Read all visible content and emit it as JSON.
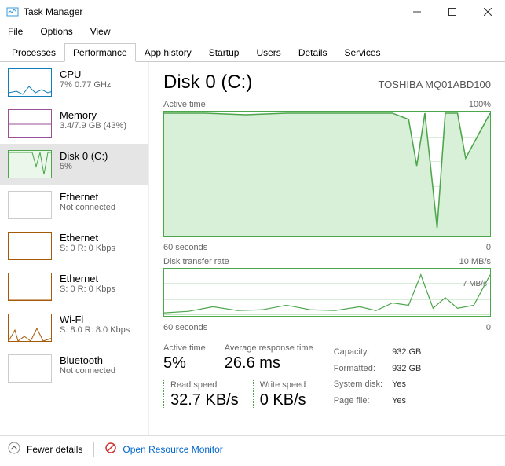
{
  "window": {
    "title": "Task Manager"
  },
  "menu": {
    "file": "File",
    "options": "Options",
    "view": "View"
  },
  "tabs": {
    "processes": "Processes",
    "performance": "Performance",
    "app_history": "App history",
    "startup": "Startup",
    "users": "Users",
    "details": "Details",
    "services": "Services"
  },
  "sidebar": [
    {
      "title": "CPU",
      "sub": "7% 0.77 GHz",
      "kind": "cpu"
    },
    {
      "title": "Memory",
      "sub": "3.4/7.9 GB (43%)",
      "kind": "mem"
    },
    {
      "title": "Disk 0 (C:)",
      "sub": "5%",
      "kind": "disk",
      "selected": true
    },
    {
      "title": "Ethernet",
      "sub": "Not connected",
      "kind": "eth0"
    },
    {
      "title": "Ethernet",
      "sub": "S: 0 R: 0 Kbps",
      "kind": "eth1"
    },
    {
      "title": "Ethernet",
      "sub": "S: 0 R: 0 Kbps",
      "kind": "eth1"
    },
    {
      "title": "Wi-Fi",
      "sub": "S: 8.0 R: 8.0 Kbps",
      "kind": "wifi"
    },
    {
      "title": "Bluetooth",
      "sub": "Not connected",
      "kind": "bt"
    }
  ],
  "main": {
    "title": "Disk 0 (C:)",
    "model": "TOSHIBA MQ01ABD100",
    "chart1": {
      "label_left": "Active time",
      "label_right": "100%",
      "axis_left": "60 seconds",
      "axis_right": "0"
    },
    "chart2": {
      "label_left": "Disk transfer rate",
      "label_right": "10 MB/s",
      "inner_right": "7 MB/s",
      "axis_left": "60 seconds",
      "axis_right": "0"
    },
    "stats": {
      "active_time_lbl": "Active time",
      "active_time_val": "5%",
      "avg_resp_lbl": "Average response time",
      "avg_resp_val": "26.6 ms",
      "read_lbl": "Read speed",
      "read_val": "32.7 KB/s",
      "write_lbl": "Write speed",
      "write_val": "0 KB/s"
    },
    "props": {
      "capacity_lbl": "Capacity:",
      "capacity_val": "932 GB",
      "formatted_lbl": "Formatted:",
      "formatted_val": "932 GB",
      "sysdisk_lbl": "System disk:",
      "sysdisk_val": "Yes",
      "pagefile_lbl": "Page file:",
      "pagefile_val": "Yes"
    }
  },
  "footer": {
    "fewer": "Fewer details",
    "rm": "Open Resource Monitor"
  },
  "chart_data": [
    {
      "type": "line",
      "title": "Active time",
      "ylabel": "%",
      "ylim": [
        0,
        100
      ],
      "xlabel": "seconds",
      "xlim": [
        60,
        0
      ],
      "x": [
        60,
        55,
        50,
        45,
        40,
        35,
        30,
        25,
        20,
        15,
        12,
        10,
        8,
        6,
        4,
        2,
        0
      ],
      "values": [
        100,
        100,
        98,
        99,
        100,
        100,
        100,
        100,
        100,
        100,
        95,
        60,
        100,
        10,
        100,
        65,
        100
      ]
    },
    {
      "type": "line",
      "title": "Disk transfer rate",
      "ylabel": "MB/s",
      "ylim": [
        0,
        10
      ],
      "annotations": [
        "7 MB/s"
      ],
      "xlabel": "seconds",
      "xlim": [
        60,
        0
      ],
      "x": [
        60,
        55,
        50,
        45,
        40,
        35,
        30,
        25,
        20,
        18,
        15,
        12,
        10,
        8,
        6,
        4,
        2,
        0
      ],
      "values": [
        0.3,
        0.4,
        1.0,
        0.5,
        0.6,
        1.5,
        0.8,
        0.5,
        1.0,
        0.3,
        2.0,
        1.5,
        7.0,
        1.0,
        3.0,
        1.0,
        1.5,
        7.0
      ]
    }
  ]
}
